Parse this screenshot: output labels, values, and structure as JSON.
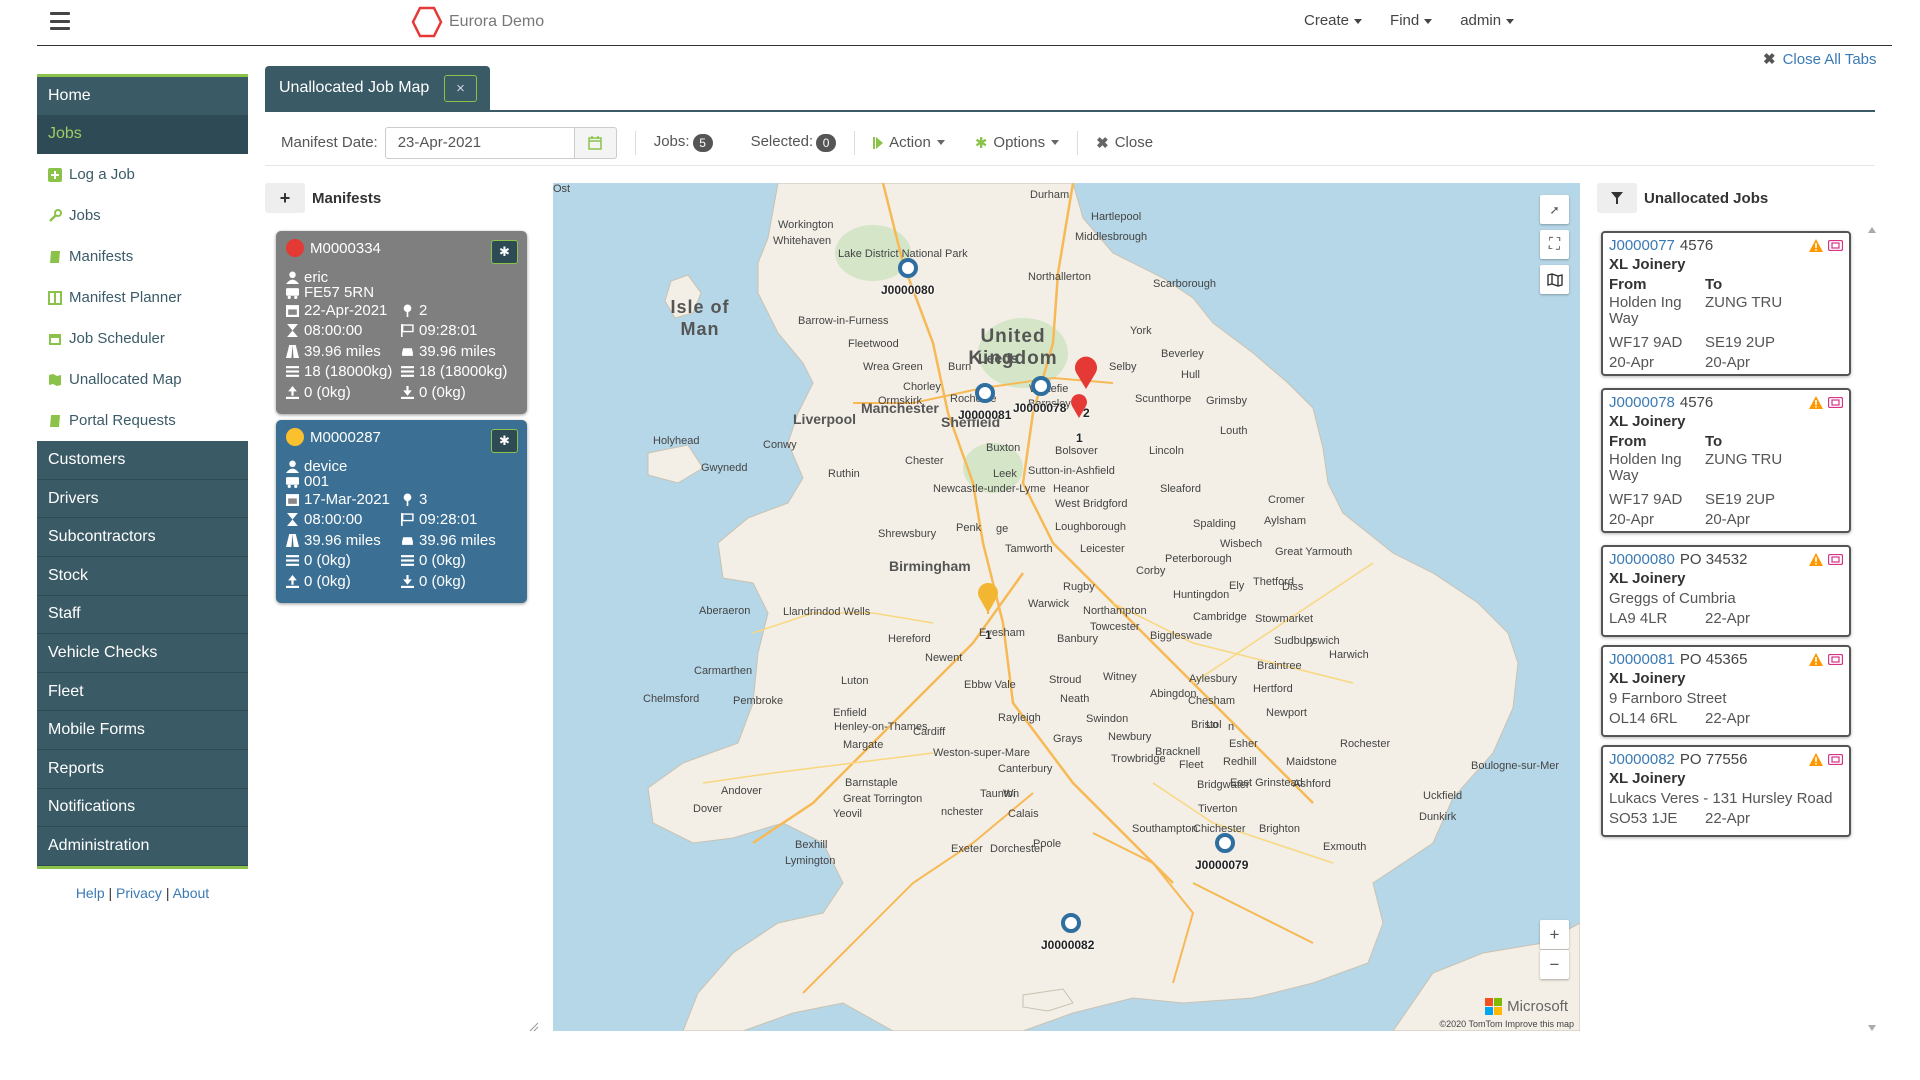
{
  "app": {
    "name": "Eurora Demo"
  },
  "topnav": [
    {
      "label": "Create"
    },
    {
      "label": "Find"
    },
    {
      "label": "admin"
    }
  ],
  "close_all_tabs": "Close All Tabs",
  "sidebar": {
    "items": [
      {
        "label": "Home",
        "type": "main"
      },
      {
        "label": "Jobs",
        "type": "main",
        "active": true
      },
      {
        "label": "Log a Job",
        "type": "sub",
        "icon": "plus-square-icon"
      },
      {
        "label": "Jobs",
        "type": "sub",
        "icon": "wrench-icon"
      },
      {
        "label": "Manifests",
        "type": "sub",
        "icon": "book-icon"
      },
      {
        "label": "Manifest Planner",
        "type": "sub",
        "icon": "columns-icon"
      },
      {
        "label": "Job Scheduler",
        "type": "sub",
        "icon": "calendar-icon"
      },
      {
        "label": "Unallocated Map",
        "type": "sub",
        "icon": "map-icon"
      },
      {
        "label": "Portal Requests",
        "type": "sub",
        "icon": "book-icon"
      },
      {
        "label": "Customers",
        "type": "main"
      },
      {
        "label": "Drivers",
        "type": "main"
      },
      {
        "label": "Subcontractors",
        "type": "main"
      },
      {
        "label": "Stock",
        "type": "main"
      },
      {
        "label": "Staff",
        "type": "main"
      },
      {
        "label": "Vehicle Checks",
        "type": "main"
      },
      {
        "label": "Fleet",
        "type": "main"
      },
      {
        "label": "Mobile Forms",
        "type": "main"
      },
      {
        "label": "Reports",
        "type": "main"
      },
      {
        "label": "Notifications",
        "type": "main"
      },
      {
        "label": "Administration",
        "type": "main"
      }
    ],
    "footer": {
      "help": "Help",
      "privacy": "Privacy",
      "about": "About",
      "sep": "|"
    }
  },
  "tab": {
    "label": "Unallocated Job Map",
    "close": "×"
  },
  "toolbar": {
    "manifest_date_label": "Manifest Date:",
    "manifest_date_value": "23-Apr-2021",
    "jobs_label": "Jobs:",
    "jobs_count": "5",
    "selected_label": "Selected:",
    "selected_count": "0",
    "action": "Action",
    "options": "Options",
    "close": "Close"
  },
  "manifests": {
    "header": "Manifests",
    "cards": [
      {
        "id": "M0000334",
        "status_color": "#e53935",
        "driver": "eric",
        "vehicle": "FE57 5RN",
        "date": "22-Apr-2021",
        "stops": "2",
        "start": "08:00:00",
        "end": "09:28:01",
        "distance1": "39.96 miles",
        "distance2": "39.96 miles",
        "load1": "18 (18000kg)",
        "load2": "18 (18000kg)",
        "unload1": "0 (0kg)",
        "unload2": "0 (0kg)"
      },
      {
        "id": "M0000287",
        "status_color": "#fbc02d",
        "driver": "device",
        "vehicle": "001",
        "date": "17-Mar-2021",
        "stops": "3",
        "start": "08:00:00",
        "end": "09:28:01",
        "distance1": "39.96 miles",
        "distance2": "39.96 miles",
        "load1": "0 (0kg)",
        "load2": "0 (0kg)",
        "unload1": "0 (0kg)",
        "unload2": "0 (0kg)"
      }
    ]
  },
  "map": {
    "labels": [
      {
        "t": "Durham"
      },
      {
        "t": "Hartlepool"
      },
      {
        "t": "Middlesbrough"
      },
      {
        "t": "Workington"
      },
      {
        "t": "Whitehaven"
      },
      {
        "t": "Lake District National Park"
      },
      {
        "t": "Northallerton"
      },
      {
        "t": "Scarborough"
      },
      {
        "t": "Barrow-in-Furness"
      },
      {
        "t": "York"
      },
      {
        "t": "Fleetwood"
      },
      {
        "t": "Beverley"
      },
      {
        "t": "Wrea Green"
      },
      {
        "t": "Burn"
      },
      {
        "t": "Selby"
      },
      {
        "t": "Hull"
      },
      {
        "t": "Chorley"
      },
      {
        "t": "Rochdale"
      },
      {
        "t": "Wakefie"
      },
      {
        "t": "Ormskirk"
      },
      {
        "t": "Barnsley"
      },
      {
        "t": "Scunthorpe"
      },
      {
        "t": "Grimsby"
      },
      {
        "t": "Holyhead"
      },
      {
        "t": "Conwy"
      },
      {
        "t": "Louth"
      },
      {
        "t": "Buxton"
      },
      {
        "t": "Bolsover"
      },
      {
        "t": "Lincoln"
      },
      {
        "t": "Gwynedd"
      },
      {
        "t": "Ruthin"
      },
      {
        "t": "Chester"
      },
      {
        "t": "Leek"
      },
      {
        "t": "Sutton-in-Ashfield"
      },
      {
        "t": "Newcastle-under-Lyme"
      },
      {
        "t": "Heanor"
      },
      {
        "t": "Sleaford"
      },
      {
        "t": "West Bridgford"
      },
      {
        "t": "Cromer"
      },
      {
        "t": "Aylsham"
      },
      {
        "t": "Shrewsbury"
      },
      {
        "t": "Penk"
      },
      {
        "t": "ge"
      },
      {
        "t": "Loughborough"
      },
      {
        "t": "Spalding"
      },
      {
        "t": "Wisbech"
      },
      {
        "t": "Tamworth"
      },
      {
        "t": "Leicester"
      },
      {
        "t": "Peterborough"
      },
      {
        "t": "Great Yarmouth"
      },
      {
        "t": "Corby"
      },
      {
        "t": "Rugby"
      },
      {
        "t": "Ely"
      },
      {
        "t": "Thetford"
      },
      {
        "t": "Diss"
      },
      {
        "t": "Huntingdon"
      },
      {
        "t": "Aberaeron"
      },
      {
        "t": "Llandrindod Wells"
      },
      {
        "t": "Warwick"
      },
      {
        "t": "Northampton"
      },
      {
        "t": "Cambridge"
      },
      {
        "t": "Stowmarket"
      },
      {
        "t": "Evesham"
      },
      {
        "t": "Banbury"
      },
      {
        "t": "Towcester"
      },
      {
        "t": "Biggleswade"
      },
      {
        "t": "Hereford"
      },
      {
        "t": "Sudbury"
      },
      {
        "t": "Ipswich"
      },
      {
        "t": "Harwich"
      },
      {
        "t": "Newent"
      },
      {
        "t": "Braintree"
      },
      {
        "t": "Carmarthen"
      },
      {
        "t": "Luton"
      },
      {
        "t": "Ebbw Vale"
      },
      {
        "t": "Stroud"
      },
      {
        "t": "Witney"
      },
      {
        "t": "Aylesbury"
      },
      {
        "t": "Hertford"
      },
      {
        "t": "Chelmsford"
      },
      {
        "t": "Pembroke"
      },
      {
        "t": "Neath"
      },
      {
        "t": "Abingdon"
      },
      {
        "t": "Chesham"
      },
      {
        "t": "Enfield"
      },
      {
        "t": "Newport"
      },
      {
        "t": "Rayleigh"
      },
      {
        "t": "Swindon"
      },
      {
        "t": "Henley-on-Thames"
      },
      {
        "t": "Cardiff"
      },
      {
        "t": "Bristol"
      },
      {
        "t": "Lo"
      },
      {
        "t": "n"
      },
      {
        "t": "Grays"
      },
      {
        "t": "Newbury"
      },
      {
        "t": "Bracknell"
      },
      {
        "t": "Esher"
      },
      {
        "t": "Rochester"
      },
      {
        "t": "Margate"
      },
      {
        "t": "Weston-super-Mare"
      },
      {
        "t": "Trowbridge"
      },
      {
        "t": "Fleet"
      },
      {
        "t": "Redhill"
      },
      {
        "t": "Maidstone"
      },
      {
        "t": "Canterbury"
      },
      {
        "t": "Andover"
      },
      {
        "t": "Barnstaple"
      },
      {
        "t": "Bridgwater"
      },
      {
        "t": "East Grinstead"
      },
      {
        "t": "Ashford"
      },
      {
        "t": "Dover"
      },
      {
        "t": "Great Torrington"
      },
      {
        "t": "Taunton"
      },
      {
        "t": "Wi"
      },
      {
        "t": "nchester"
      },
      {
        "t": "Yeovil"
      },
      {
        "t": "Tiverton"
      },
      {
        "t": "Uckfield"
      },
      {
        "t": "Dunkirk"
      },
      {
        "t": "Calais"
      },
      {
        "t": "Southampton"
      },
      {
        "t": "Chichester"
      },
      {
        "t": "Brighton"
      },
      {
        "t": "Bexhill"
      },
      {
        "t": "Exeter"
      },
      {
        "t": "Dorchester"
      },
      {
        "t": "Poole"
      },
      {
        "t": "Lymington"
      },
      {
        "t": "Exmouth"
      },
      {
        "t": "Boulogne-sur-Mer"
      },
      {
        "t": "Ost"
      }
    ],
    "cities": [
      {
        "t": "Liverpool"
      },
      {
        "t": "Manchester"
      },
      {
        "t": "Sheffield"
      },
      {
        "t": "Birmingham"
      },
      {
        "t": "Leeds"
      }
    ],
    "country": "United Kingdom",
    "isle": "Isle of Man",
    "pins": [
      {
        "job": "J0000080",
        "kind": "blue"
      },
      {
        "job": "J0000081",
        "kind": "blue"
      },
      {
        "job": "J0000078",
        "kind": "blue"
      },
      {
        "job": "J0000079",
        "kind": "blue"
      },
      {
        "job": "J0000082",
        "kind": "blue"
      },
      {
        "job": "2",
        "kind": "red"
      },
      {
        "job": "1",
        "kind": "red-small"
      },
      {
        "job": "1",
        "kind": "yellow"
      }
    ],
    "brand": "Microsoft",
    "attribution": "©2020 TomTom  Improve this map",
    "zoom_in": "+",
    "zoom_out": "−"
  },
  "unallocated": {
    "header": "Unallocated Jobs",
    "jobs": [
      {
        "id": "J0000077",
        "ref": "4576",
        "company": "XL Joinery",
        "from_label": "From",
        "to_label": "To",
        "from_addr": "Holden Ing Way",
        "to_addr": "ZUNG TRU",
        "from_pc": "WF17 9AD",
        "to_pc": "SE19 2UP",
        "from_date": "20-Apr",
        "to_date": "20-Apr"
      },
      {
        "id": "J0000078",
        "ref": "4576",
        "company": "XL Joinery",
        "from_label": "From",
        "to_label": "To",
        "from_addr": "Holden Ing Way",
        "to_addr": "ZUNG TRU",
        "from_pc": "WF17 9AD",
        "to_pc": "SE19 2UP",
        "from_date": "20-Apr",
        "to_date": "20-Apr"
      },
      {
        "id": "J0000080",
        "ref": "PO 34532",
        "company": "XL Joinery",
        "addr": "Greggs of Cumbria",
        "pc": "LA9 4LR",
        "date": "22-Apr"
      },
      {
        "id": "J0000081",
        "ref": "PO 45365",
        "company": "XL Joinery",
        "addr": "9 Farnboro Street",
        "pc": "OL14 6RL",
        "date": "22-Apr"
      },
      {
        "id": "J0000082",
        "ref": "PO 77556",
        "company": "XL Joinery",
        "addr": "Lukacs Veres - 131 Hursley Road",
        "pc": "SO53 1JE",
        "date": "22-Apr"
      }
    ]
  },
  "colors": {
    "sidebar": "#3a5a66",
    "accent": "#8bc34a",
    "link": "#3a7ab4",
    "warning": "#ff9800",
    "pink": "#d63384"
  }
}
